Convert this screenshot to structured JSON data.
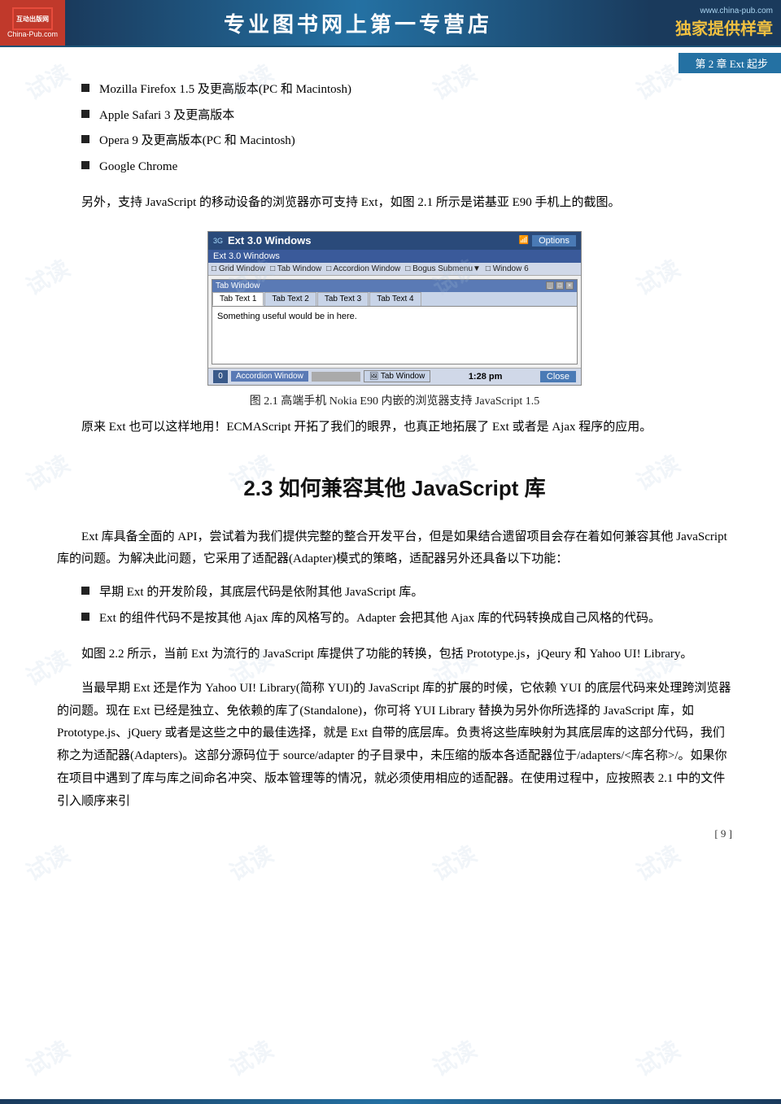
{
  "header": {
    "logo_line1": "互动出版网",
    "logo_line2": "China-Pub.com",
    "center_text": "专业图书网上第一专营店",
    "url": "www.china-pub.com",
    "sample_text": "独家提供样章"
  },
  "chapter_label": "第 2 章   Ext 起步",
  "bullets": [
    "Mozilla Firefox 1.5 及更高版本(PC 和 Macintosh)",
    "Apple Safari 3 及更高版本",
    "Opera 9 及更高版本(PC 和 Macintosh)",
    "Google Chrome"
  ],
  "paragraph1": "另外，支持 JavaScript 的移动设备的浏览器亦可支持 Ext，如图 2.1 所示是诺基亚 E90 手机上的截图。",
  "figure": {
    "topbar_title": "Ext 3.0 Windows",
    "topbar_signal": "3G",
    "options_btn": "Options",
    "subtitle": "Ext 3.0 Windows",
    "toolbar_items": [
      "Grid Window",
      "Tab Window",
      "Accordion Window",
      "Bogus Submenu▼",
      "Window 6"
    ],
    "window_title": "Tab Window",
    "tabs": [
      "Tab Text 1",
      "Tab Text 2",
      "Tab Text 3",
      "Tab Text 4"
    ],
    "content_text": "Something useful would be in here.",
    "accordion_label": "Accordion Window",
    "tabwin_label": "Tab Window",
    "time": "1:28 pm",
    "close_btn": "Close",
    "num": "0",
    "caption": "图 2.1    高端手机 Nokia E90 内嵌的浏览器支持 JavaScript 1.5"
  },
  "paragraph2": "原来 Ext 也可以这样地用！ECMAScript 开拓了我们的眼界，也真正地拓展了 Ext 或者是 Ajax 程序的应用。",
  "section_title": "2.3    如何兼容其他 JavaScript 库",
  "paragraph3": "Ext 库具备全面的 API，尝试着为我们提供完整的整合开发平台，但是如果结合遗留项目会存在着如何兼容其他 JavaScript 库的问题。为解决此问题，它采用了适配器(Adapter)模式的策略，适配器另外还具备以下功能：",
  "bullets2": [
    "早期 Ext 的开发阶段，其底层代码是依附其他 JavaScript 库。",
    "Ext 的组件代码不是按其他 Ajax 库的风格写的。Adapter 会把其他 Ajax 库的代码转换成自己风格的代码。"
  ],
  "paragraph4": "如图 2.2 所示，当前 Ext 为流行的 JavaScript 库提供了功能的转换，包括 Prototype.js，jQeury 和 Yahoo UI! Library。",
  "paragraph5": "当最早期 Ext 还是作为 Yahoo UI! Library(简称 YUI)的 JavaScript 库的扩展的时候，它依赖 YUI 的底层代码来处理跨浏览器的问题。现在 Ext 已经是独立、免依赖的库了(Standalone)，你可将 YUI  Library 替换为另外你所选择的 JavaScript 库，如 Prototype.js、jQuery 或者是这些之中的最佳选择，就是 Ext 自带的底层库。负责将这些库映射为其底层库的这部分代码，我们称之为适配器(Adapters)。这部分源码位于 source/adapter 的子目录中，未压缩的版本各适配器位于/adapters/<库名称>/。如果你在项目中遇到了库与库之间命名冲突、版本管理等的情况，就必须使用相应的适配器。在使用过程中，应按照表 2.1 中的文件引入顺序来引",
  "page_number": "[ 9 ]",
  "watermarks": [
    "试读",
    "试读",
    "试读",
    "试读",
    "试读",
    "试读",
    "试读",
    "试读",
    "试读",
    "试读",
    "试读",
    "试读"
  ]
}
